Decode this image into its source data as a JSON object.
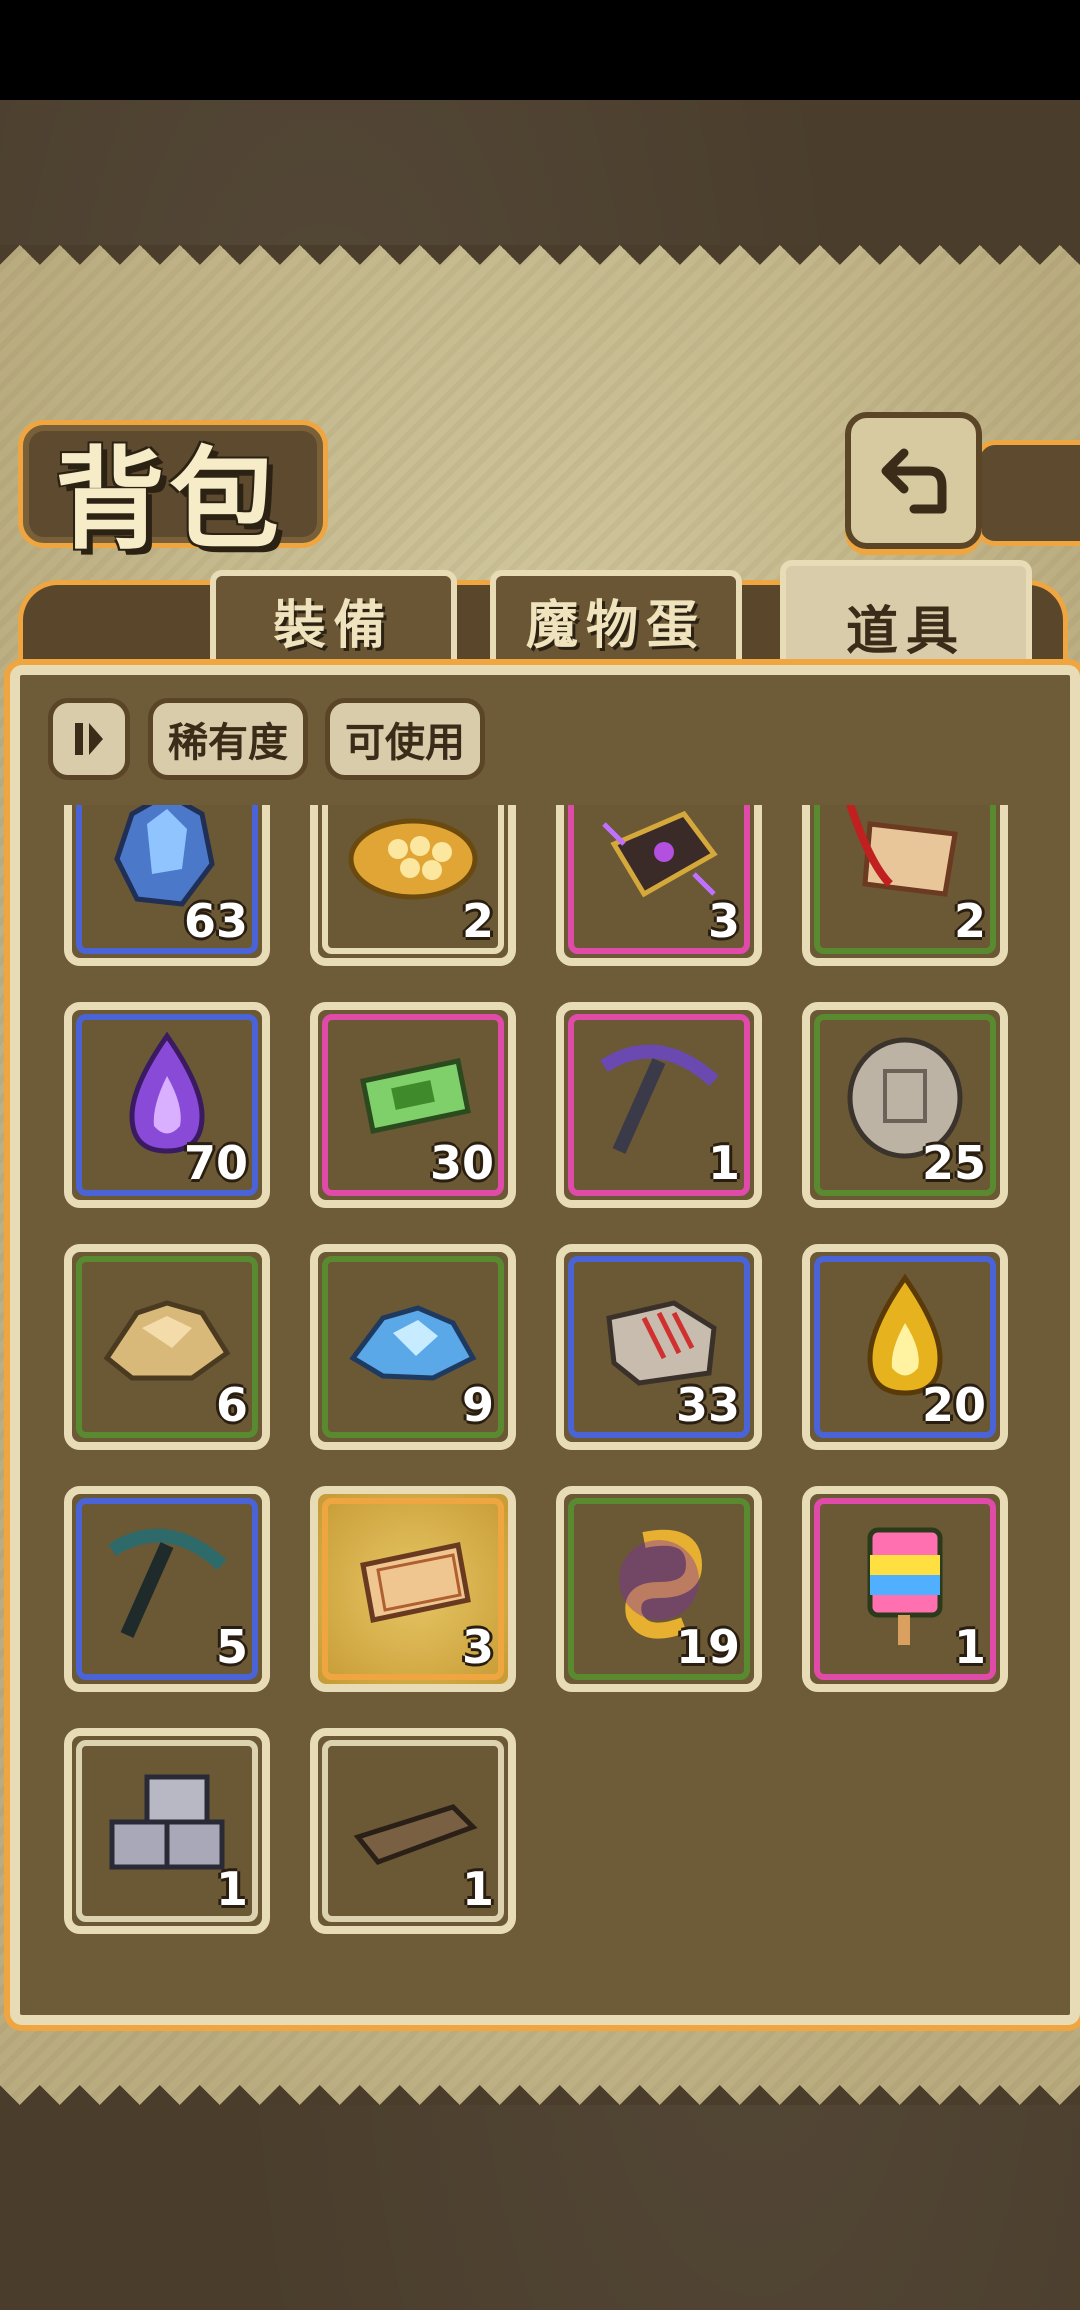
{
  "header": {
    "title": "背包"
  },
  "tabs": [
    {
      "label": "裝備",
      "active": false
    },
    {
      "label": "魔物蛋",
      "active": false
    },
    {
      "label": "道具",
      "active": true
    }
  ],
  "filters": {
    "rarity_label": "稀有度",
    "usable_label": "可使用"
  },
  "rarity_colors": {
    "blue": "#4a63d6",
    "beige": "#e8dcb6",
    "pink": "#e04aa8",
    "green": "#5a8a30",
    "gold": "#f0a640",
    "gray": "#ddd2b0"
  },
  "items": [
    {
      "icon": "crystal-ore-icon",
      "count": "63",
      "rarity": "blue"
    },
    {
      "icon": "honeycomb-icon",
      "count": "2",
      "rarity": "beige"
    },
    {
      "icon": "magic-book-icon",
      "count": "3",
      "rarity": "pink"
    },
    {
      "icon": "tag-charm-icon",
      "count": "2",
      "rarity": "green"
    },
    {
      "icon": "purple-flame-icon",
      "count": "70",
      "rarity": "blue"
    },
    {
      "icon": "green-ticket-icon",
      "count": "30",
      "rarity": "pink"
    },
    {
      "icon": "purple-pickaxe-icon",
      "count": "1",
      "rarity": "pink"
    },
    {
      "icon": "stone-coin-icon",
      "count": "25",
      "rarity": "green"
    },
    {
      "icon": "gold-ore-icon",
      "count": "6",
      "rarity": "green"
    },
    {
      "icon": "blue-crystal-icon",
      "count": "9",
      "rarity": "green"
    },
    {
      "icon": "clawed-stone-icon",
      "count": "33",
      "rarity": "blue"
    },
    {
      "icon": "gold-flame-icon",
      "count": "20",
      "rarity": "blue"
    },
    {
      "icon": "teal-pickaxe-icon",
      "count": "5",
      "rarity": "blue"
    },
    {
      "icon": "gold-ticket-icon",
      "count": "3",
      "rarity": "gold"
    },
    {
      "icon": "gold-swirl-icon",
      "count": "19",
      "rarity": "green"
    },
    {
      "icon": "rainbow-popsicle-icon",
      "count": "1",
      "rarity": "pink"
    },
    {
      "icon": "stone-bricks-icon",
      "count": "1",
      "rarity": "gray"
    },
    {
      "icon": "wood-plank-icon",
      "count": "1",
      "rarity": "gray"
    }
  ]
}
